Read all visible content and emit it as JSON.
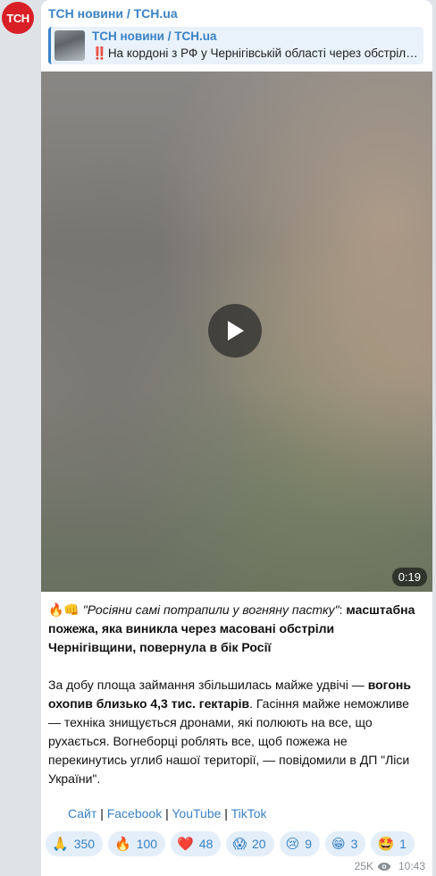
{
  "channel": {
    "avatar_text": "ТСН",
    "name": "ТСН новини / TCH.ua"
  },
  "forwarded": {
    "title": "ТСН новини / TCH.ua",
    "bang": "‼️",
    "preview": "На кордоні з РФ у Чернігівській області через обстріли…"
  },
  "video": {
    "duration": "0:19",
    "play_icon": "play-icon"
  },
  "caption": {
    "emoji": "🔥👊",
    "quote": "\"Росіяни самі потрапили у вогняну пастку\"",
    "colon": ":",
    "headline": "масштабна пожежа, яка виникла через масовані обстріли Чернігівщини, повернула в бік Росії",
    "p2_start": "За добу площа займання збільшилась майже удвічі — ",
    "p2_bold": "вогонь охопив близько 4,3 тис. гектарів",
    "p2_end": ". Гасіння майже неможливе — техніка знищується дронами, які полюють на все, що рухається. Вогнеборці роблять все, щоб пожежа не перекинутись углиб нашої території, — повідомили в ДП \"Ліси України\"."
  },
  "links": [
    "Сайт",
    "Facebook",
    "YouTube",
    "TikTok"
  ],
  "link_separator": "|",
  "reactions": [
    {
      "emoji": "🙏",
      "count": "350"
    },
    {
      "emoji": "🔥",
      "count": "100"
    },
    {
      "emoji": "❤️",
      "count": "48"
    },
    {
      "emoji": "😱",
      "count": "20"
    },
    {
      "emoji": "😢",
      "count": "9"
    },
    {
      "emoji": "😁",
      "count": "3"
    },
    {
      "emoji": "🤩",
      "count": "1"
    }
  ],
  "meta": {
    "views": "25K",
    "time": "10:43"
  },
  "colors": {
    "accent": "#3a82c4",
    "avatar_bg": "#d81f26",
    "reaction_bg": "#e3eef9"
  }
}
